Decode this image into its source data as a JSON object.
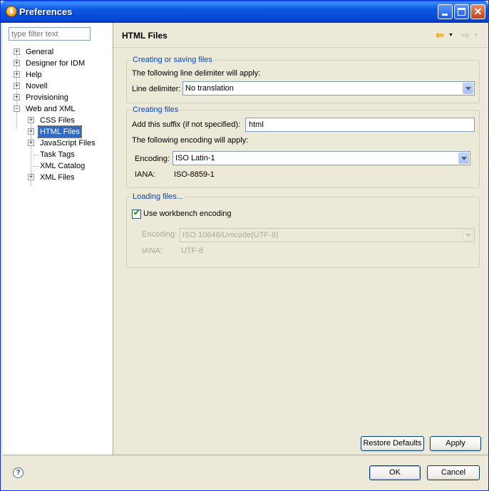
{
  "window": {
    "title": "Preferences"
  },
  "filter": {
    "placeholder": "type filter text"
  },
  "tree": {
    "general": "General",
    "designer": "Designer for IDM",
    "help": "Help",
    "novell": "Novell",
    "provisioning": "Provisioning",
    "web_xml": "Web and XML",
    "css": "CSS Files",
    "html": "HTML Files",
    "javascript": "JavaScript Files",
    "task_tags": "Task Tags",
    "xml_catalog": "XML Catalog",
    "xml_files": "XML Files",
    "expand_glyph": "+",
    "collapse_glyph": "−"
  },
  "page": {
    "title": "HTML Files",
    "nav": {
      "back": "⇦",
      "forward": "⇨",
      "dropdown": "▼"
    }
  },
  "creating_saving": {
    "legend": "Creating or saving files",
    "delimiter_intro": "The following line delimiter will apply:",
    "delimiter_label": "Line delimiter:",
    "delimiter_value": "No translation"
  },
  "creating": {
    "legend": "Creating files",
    "suffix_label": "Add this suffix (if not specified):",
    "suffix_value": "html",
    "encoding_intro": "The following encoding will apply:",
    "encoding_label": "Encoding:",
    "encoding_value": "ISO Latin-1",
    "iana_label": "IANA:",
    "iana_value": "ISO-8859-1"
  },
  "loading": {
    "legend": "Loading files...",
    "use_workbench_label": "Use workbench encoding",
    "use_workbench_checked": true,
    "check_glyph": "✔",
    "encoding_label": "Encoding:",
    "encoding_value": "ISO 10646/Unicode(UTF-8)",
    "iana_label": "IANA:",
    "iana_value": "UTF-8"
  },
  "buttons": {
    "restore_defaults": "Restore Defaults",
    "apply": "Apply",
    "ok": "OK",
    "cancel": "Cancel",
    "help": "?"
  }
}
